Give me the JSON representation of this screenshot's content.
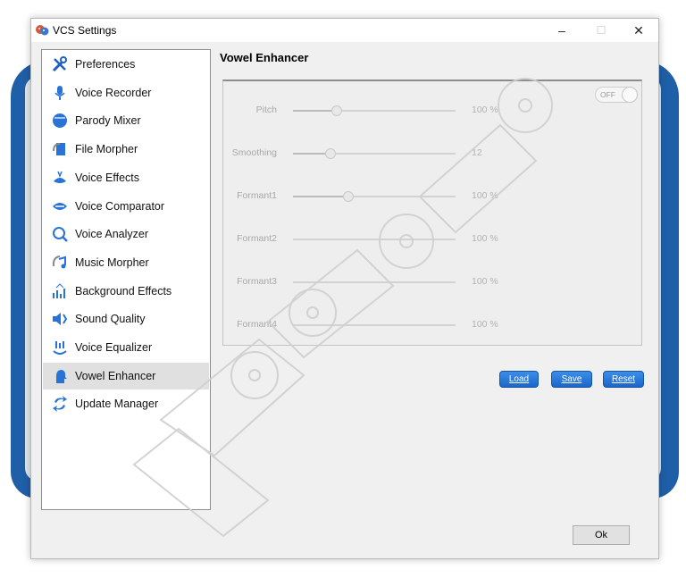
{
  "window": {
    "title": "VCS Settings",
    "minimize": "–",
    "maximize": "☐",
    "close": "✕"
  },
  "sidebar": {
    "items": [
      {
        "label": "Preferences",
        "icon": "wrench-screwdriver-icon"
      },
      {
        "label": "Voice Recorder",
        "icon": "microphone-icon"
      },
      {
        "label": "Parody Mixer",
        "icon": "mixer-face-icon"
      },
      {
        "label": "File Morpher",
        "icon": "file-morph-icon"
      },
      {
        "label": "Voice Effects",
        "icon": "voice-effects-icon"
      },
      {
        "label": "Voice Comparator",
        "icon": "comparator-icon"
      },
      {
        "label": "Voice Analyzer",
        "icon": "analyzer-magnifier-icon"
      },
      {
        "label": "Music Morpher",
        "icon": "music-note-icon"
      },
      {
        "label": "Background Effects",
        "icon": "background-effects-icon"
      },
      {
        "label": "Sound Quality",
        "icon": "speaker-icon"
      },
      {
        "label": "Voice Equalizer",
        "icon": "equalizer-icon"
      },
      {
        "label": "Vowel Enhancer",
        "icon": "vowel-head-icon"
      },
      {
        "label": "Update Manager",
        "icon": "update-arrows-icon"
      }
    ],
    "active_index": 11
  },
  "panel": {
    "title": "Vowel Enhancer",
    "toggle_label": "OFF",
    "sliders": [
      {
        "name": "Pitch",
        "value": "100 %",
        "position": 0.27
      },
      {
        "name": "Smoothing",
        "value": "12",
        "position": 0.23
      },
      {
        "name": "Formant1",
        "value": "100 %",
        "position": 0.34
      },
      {
        "name": "Formant2",
        "value": "100 %",
        "position": 0.0
      },
      {
        "name": "Formant3",
        "value": "100 %",
        "position": 0.0
      },
      {
        "name": "Formant4",
        "value": "100 %",
        "position": 0.0
      }
    ]
  },
  "buttons": {
    "load": "Load",
    "save": "Save",
    "reset": "Reset",
    "ok": "Ok"
  },
  "colors": {
    "accent_blue": "#1c66c9",
    "active_item": "#e0e0e0"
  }
}
